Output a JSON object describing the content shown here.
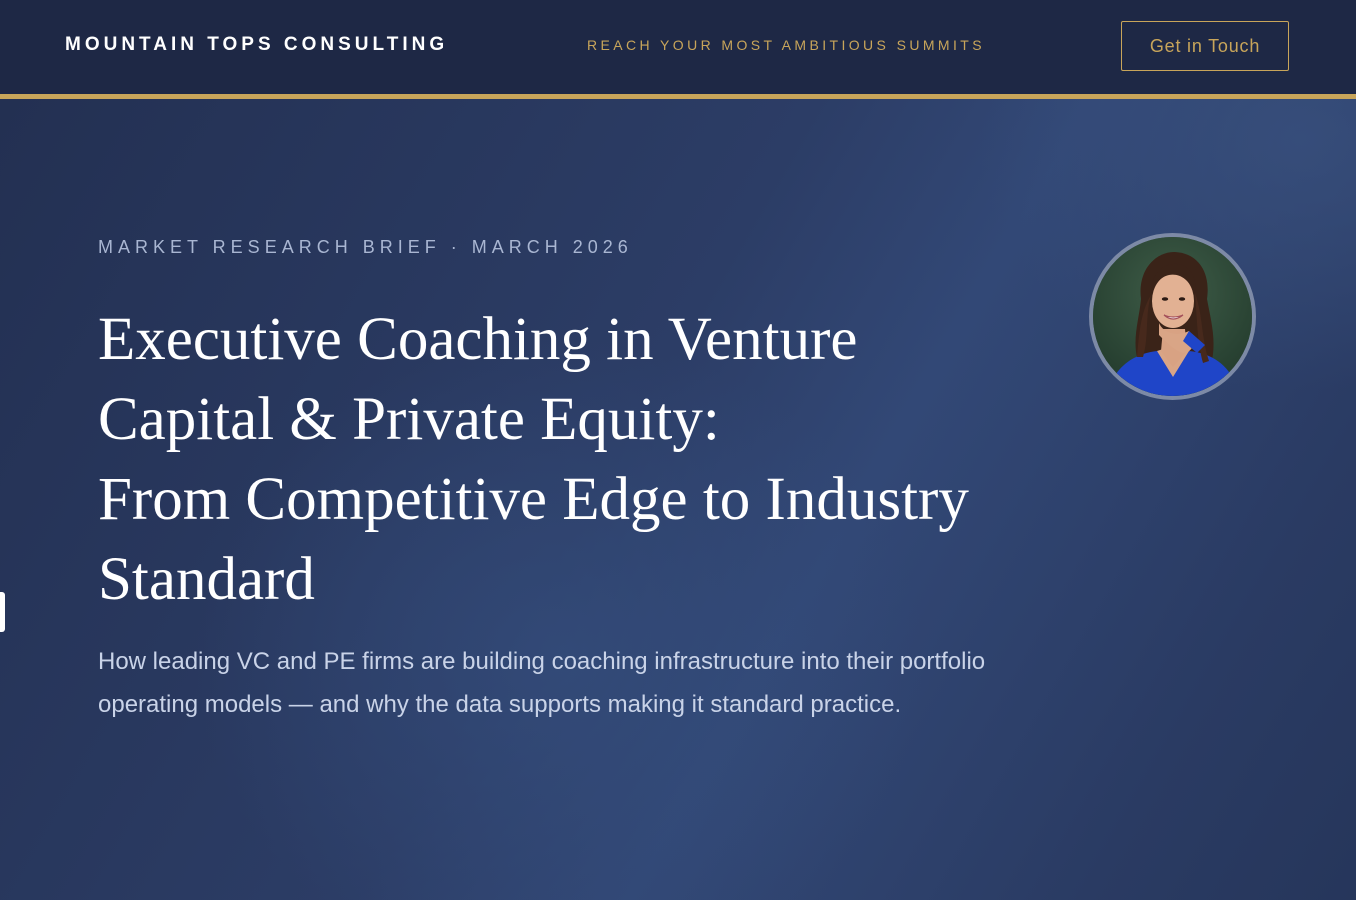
{
  "header": {
    "brand": "MOUNTAIN TOPS CONSULTING",
    "tagline": "REACH YOUR MOST AMBITIOUS SUMMITS",
    "cta_label": "Get in Touch"
  },
  "hero": {
    "eyebrow": "MARKET RESEARCH BRIEF · MARCH 2026",
    "title_lines": [
      "Executive Coaching in Venture",
      "Capital & Private Equity:",
      "From Competitive Edge to Industry",
      "Standard"
    ],
    "subtitle": "How leading VC and PE firms are building coaching infrastructure into their portfolio operating models — and why the data supports making it standard practice."
  },
  "colors": {
    "navy": "#1e2845",
    "gold": "#c8a55a",
    "white": "#ffffff"
  }
}
